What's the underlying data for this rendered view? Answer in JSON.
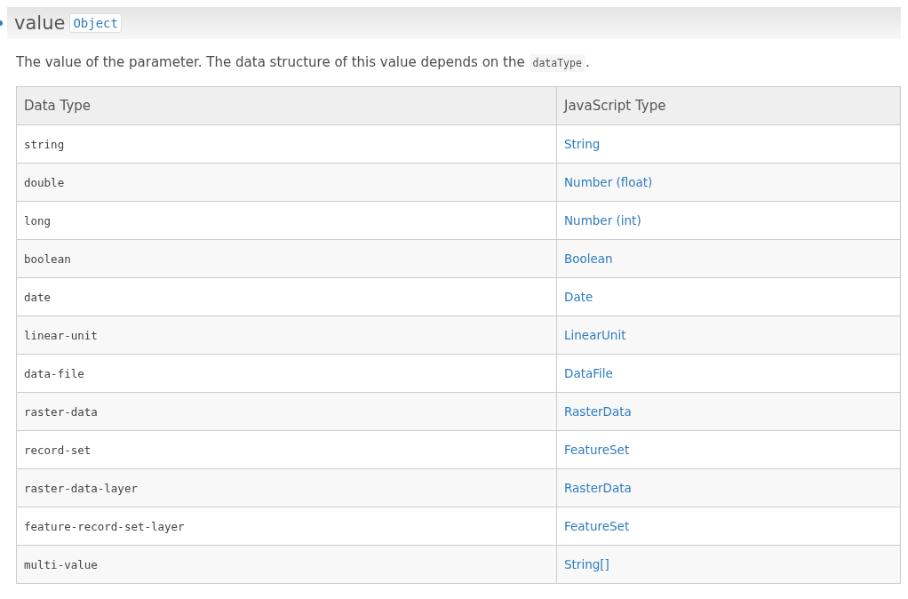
{
  "heading": {
    "name": "value",
    "type": "Object"
  },
  "description": {
    "before": "The value of the parameter. The data structure of this value depends on the",
    "code": "dataType",
    "after": "."
  },
  "table": {
    "columns": [
      "Data Type",
      "JavaScript Type"
    ],
    "rows": [
      {
        "data_type": "string",
        "js_type": "String"
      },
      {
        "data_type": "double",
        "js_type": "Number (float)"
      },
      {
        "data_type": "long",
        "js_type": "Number (int)"
      },
      {
        "data_type": "boolean",
        "js_type": "Boolean"
      },
      {
        "data_type": "date",
        "js_type": "Date"
      },
      {
        "data_type": "linear-unit",
        "js_type": "LinearUnit"
      },
      {
        "data_type": "data-file",
        "js_type": "DataFile"
      },
      {
        "data_type": "raster-data",
        "js_type": "RasterData"
      },
      {
        "data_type": "record-set",
        "js_type": "FeatureSet"
      },
      {
        "data_type": "raster-data-layer",
        "js_type": "RasterData"
      },
      {
        "data_type": "feature-record-set-layer",
        "js_type": "FeatureSet"
      },
      {
        "data_type": "multi-value",
        "js_type": "String[]"
      }
    ]
  }
}
